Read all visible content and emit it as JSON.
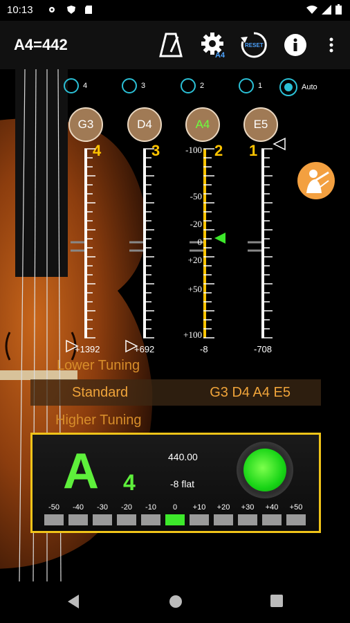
{
  "status": {
    "time": "10:13"
  },
  "appbar": {
    "title": "A4=442",
    "reset_label": "RESET",
    "gear_badge": "A4"
  },
  "radios": [
    {
      "label": "4",
      "selected": false
    },
    {
      "label": "3",
      "selected": false
    },
    {
      "label": "2",
      "selected": false
    },
    {
      "label": "1",
      "selected": false
    },
    {
      "label": "Auto",
      "selected": true
    }
  ],
  "strings": [
    {
      "note": "G3",
      "number": "4",
      "active": false,
      "bottom": "+1392"
    },
    {
      "note": "D4",
      "number": "3",
      "active": false,
      "bottom": "+692"
    },
    {
      "note": "A4",
      "number": "2",
      "active": true,
      "bottom": "-8"
    },
    {
      "note": "E5",
      "number": "1",
      "active": false,
      "bottom": "-708"
    }
  ],
  "scale_labels": [
    "-100",
    "-50",
    "-20",
    "0",
    "+20",
    "+50",
    "+100"
  ],
  "tuning": {
    "lower": "Lower Tuning",
    "name": "Standard",
    "notes": "G3 D4 A4 E5",
    "higher": "Higher Tuning"
  },
  "readout": {
    "note": "A",
    "octave": "4",
    "frequency": "440.00",
    "deviation": "-8 flat",
    "meter_labels": [
      "-50",
      "-40",
      "-30",
      "-20",
      "-10",
      "0",
      "+10",
      "+20",
      "+30",
      "+40",
      "+50"
    ],
    "active_index": 5
  },
  "colors": {
    "accent": "#2bc0d6",
    "scale": "#ffc400",
    "in_tune": "#3de82b",
    "panel_border": "#f0c419"
  },
  "icons": [
    "metronome-icon",
    "settings-icon",
    "reset-icon",
    "info-icon",
    "more-icon",
    "fiddler-icon"
  ]
}
